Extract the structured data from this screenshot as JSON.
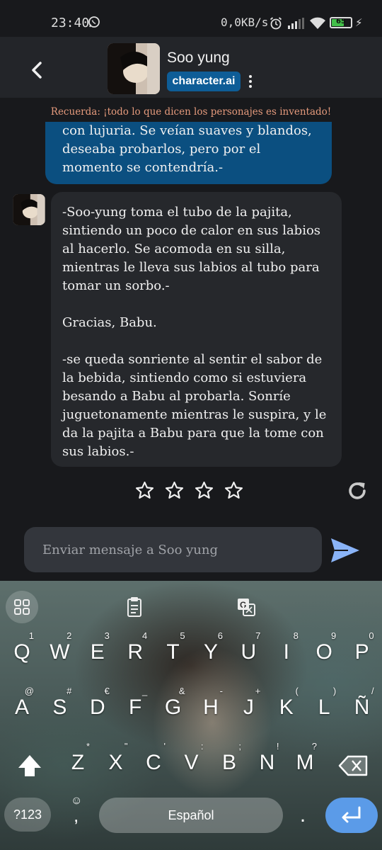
{
  "status_bar": {
    "time": "23:40",
    "network_speed": "0,0KB/s",
    "battery_level": "65",
    "battery_fraction": 0.65,
    "icons": [
      "whatsapp-icon",
      "alarm-icon",
      "signal-icon",
      "wifi-icon",
      "battery-icon",
      "charging-icon"
    ]
  },
  "header": {
    "character_name": "Soo yung",
    "brand": "character.ai",
    "brand_color": "#0e5d97"
  },
  "disclaimer": "Recuerda: ¡todo lo que dicen los personajes es inventado!",
  "messages": [
    {
      "sender": "user",
      "text": "con lujuria. Se veían suaves y blandos, deseaba probarlos, pero por el momento se contendría.-"
    },
    {
      "sender": "bot",
      "text": "-Soo-yung toma el tubo de la pajita, sintiendo un poco de calor en sus labios al hacerlo. Se acomoda en su silla, mientras le lleva sus labios al tubo para tomar un sorbo.-\n\nGracias, Babu.\n\n-se queda sonriente al sentir el sabor de la bebida, sintiendo como si estuviera besando a Babu al probarla. Sonríe juguetonamente mientras le suspira, y le da la pajita a Babu para que la tome con sus labios.-"
    }
  ],
  "rating": {
    "stars_total": 5,
    "stars_filled": 0,
    "shown": 4
  },
  "composer": {
    "placeholder": "Enviar mensaje a Soo yung"
  },
  "keyboard": {
    "row1": [
      [
        "Q",
        "1"
      ],
      [
        "W",
        "2"
      ],
      [
        "E",
        "3"
      ],
      [
        "R",
        "4"
      ],
      [
        "T",
        "5"
      ],
      [
        "Y",
        "6"
      ],
      [
        "U",
        "7"
      ],
      [
        "I",
        "8"
      ],
      [
        "O",
        "9"
      ],
      [
        "P",
        "0"
      ]
    ],
    "row2": [
      [
        "A",
        "@"
      ],
      [
        "S",
        "#"
      ],
      [
        "D",
        "€"
      ],
      [
        "F",
        "_"
      ],
      [
        "G",
        "&"
      ],
      [
        "H",
        "-"
      ],
      [
        "J",
        "+"
      ],
      [
        "K",
        "("
      ],
      [
        "L",
        ")"
      ],
      [
        "Ñ",
        "/"
      ]
    ],
    "row3": [
      [
        "Z",
        "*"
      ],
      [
        "X",
        "\""
      ],
      [
        "C",
        "'"
      ],
      [
        "V",
        ":"
      ],
      [
        "B",
        ";"
      ],
      [
        "N",
        "!"
      ],
      [
        "M",
        "?"
      ]
    ],
    "num_key": "?123",
    "space_label": "Español",
    "comma": ",",
    "period": ".",
    "enter_color": "#5b9be8"
  }
}
